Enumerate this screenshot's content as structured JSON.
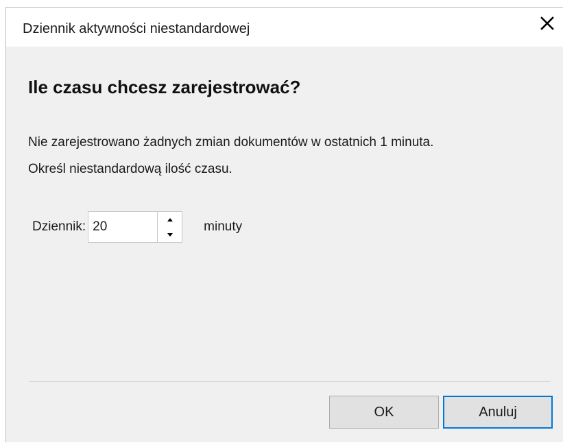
{
  "window": {
    "title": "Dziennik aktywności niestandardowej",
    "close_icon": "close-icon"
  },
  "dialog": {
    "heading": "Ile czasu chcesz zarejestrować?",
    "message_line1": "Nie zarejestrowano żadnych zmian dokumentów w ostatnich 1 minuta.",
    "message_line2": "Określ niestandardową ilość czasu."
  },
  "log_field": {
    "label": "Dziennik:",
    "value": "20",
    "unit": "minuty",
    "up_icon": "arrow-up-icon",
    "down_icon": "arrow-down-icon"
  },
  "buttons": {
    "ok_label": "OK",
    "cancel_label": "Anuluj"
  },
  "colors": {
    "dialog_background": "#f0f0f0",
    "focus_border": "#0078d7",
    "button_background": "#e1e1e1"
  }
}
